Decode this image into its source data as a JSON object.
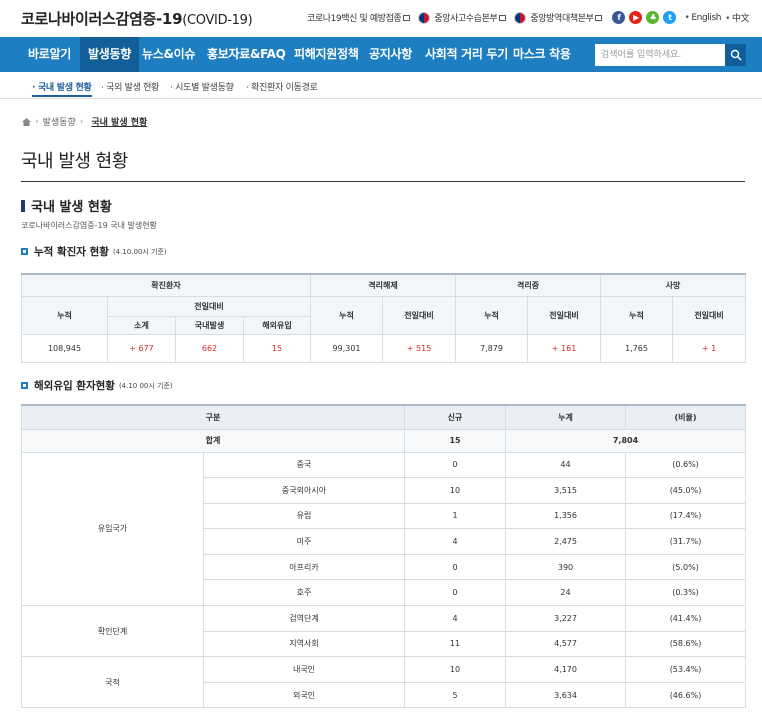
{
  "header": {
    "site_title": "코로나바이러스감염증-19",
    "site_title_sub": "(COVID-19)",
    "links": [
      {
        "label": "코로나19백신 및 예방접종"
      },
      {
        "label": "중앙사고수습본부"
      },
      {
        "label": "중앙방역대책본부"
      }
    ],
    "sns": [
      "f",
      "▶",
      "♣",
      "t"
    ],
    "lang_english": "English",
    "lang_chinese": "中文"
  },
  "nav": {
    "items": [
      "바로알기",
      "발생동향",
      "뉴스&이슈",
      "홍보자료&FAQ",
      "피해지원정책",
      "공지사항",
      "사회적 거리 두기",
      "마스크 착용"
    ],
    "active": "발생동향",
    "search_placeholder": "검색어를 입력하세요."
  },
  "subnav": {
    "items": [
      "국내 발생 현황",
      "국외 발생 현황",
      "시도별 발생동향",
      "확진환자 이동경로"
    ]
  },
  "breadcrumb": {
    "parent": "발생동향",
    "current": "국내 발생 현황"
  },
  "page_title": "국내 발생 현황",
  "section": {
    "title": "국내 발생 현황",
    "desc": "코로나바이러스감염증-19 국내 발생현황"
  },
  "cumulative": {
    "title": "누적 확진자 현황",
    "date": "(4.10.00시 기준)",
    "headers": {
      "confirmed": "확진환자",
      "released": "격리해제",
      "isolated": "격리중",
      "deaths": "사망",
      "total": "누적",
      "daily": "전일대비",
      "subtotal": "소계",
      "domestic": "국내발생",
      "imported": "해외유입"
    },
    "values": {
      "confirmed_total": "108,945",
      "confirmed_subtotal": "+ 677",
      "confirmed_domestic": "662",
      "confirmed_imported": "15",
      "released_total": "99,301",
      "released_daily": "+ 515",
      "isolated_total": "7,879",
      "isolated_daily": "+ 161",
      "deaths_total": "1,765",
      "deaths_daily": "+ 1"
    }
  },
  "imported": {
    "title": "해외유입 환자현황",
    "date": "(4.10 00시 기준)",
    "headers": [
      "구분",
      "신규",
      "누계",
      "(비율)"
    ],
    "total": {
      "label": "합계",
      "new": "15",
      "cum": "7,804"
    },
    "groups": [
      {
        "name": "유입국가",
        "rows": [
          {
            "label": "중국",
            "new": "0",
            "cum": "44",
            "ratio": "(0.6%)"
          },
          {
            "label": "중국외아시아",
            "new": "10",
            "cum": "3,515",
            "ratio": "(45.0%)"
          },
          {
            "label": "유럽",
            "new": "1",
            "cum": "1,356",
            "ratio": "(17.4%)"
          },
          {
            "label": "미주",
            "new": "4",
            "cum": "2,475",
            "ratio": "(31.7%)"
          },
          {
            "label": "아프리카",
            "new": "0",
            "cum": "390",
            "ratio": "(5.0%)"
          },
          {
            "label": "호주",
            "new": "0",
            "cum": "24",
            "ratio": "(0.3%)"
          }
        ]
      },
      {
        "name": "확인단계",
        "rows": [
          {
            "label": "검역단계",
            "new": "4",
            "cum": "3,227",
            "ratio": "(41.4%)"
          },
          {
            "label": "지역사회",
            "new": "11",
            "cum": "4,577",
            "ratio": "(58.6%)"
          }
        ]
      },
      {
        "name": "국적",
        "rows": [
          {
            "label": "내국인",
            "new": "10",
            "cum": "4,170",
            "ratio": "(53.4%)"
          },
          {
            "label": "외국인",
            "new": "5",
            "cum": "3,634",
            "ratio": "(46.6%)"
          }
        ]
      }
    ]
  }
}
